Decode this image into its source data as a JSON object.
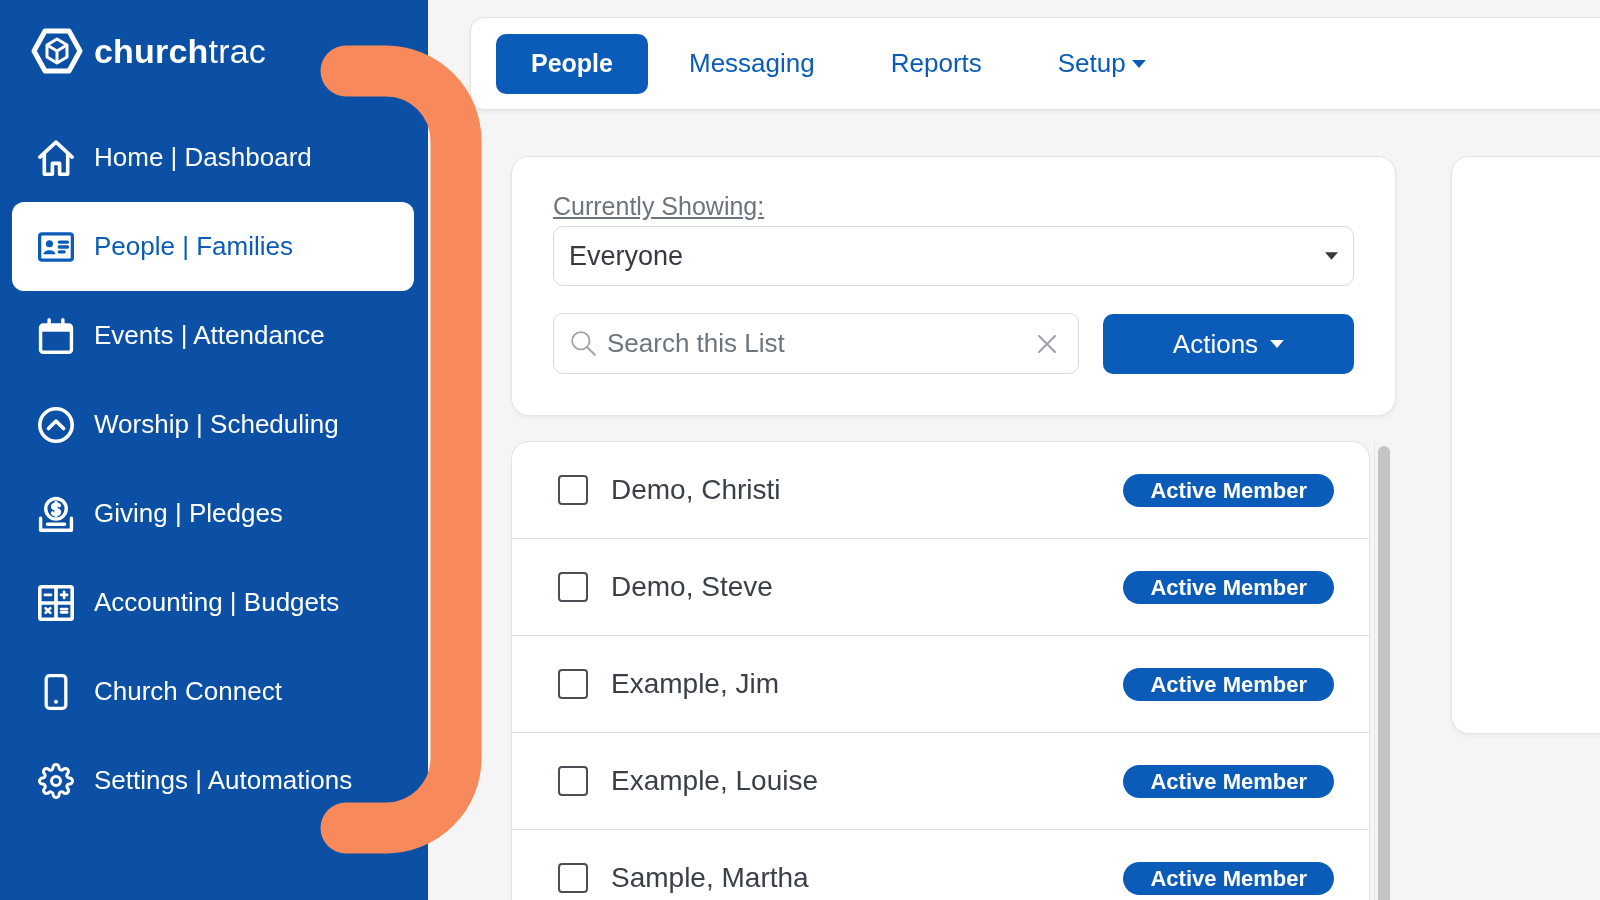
{
  "logo": {
    "wordmark": "**church**trac"
  },
  "sidebar": {
    "items": [
      {
        "label": "Home | Dashboard",
        "selected": false
      },
      {
        "label": "People | Families",
        "selected": true
      },
      {
        "label": "Events | Attendance",
        "selected": false
      },
      {
        "label": "Worship | Scheduling",
        "selected": false
      },
      {
        "label": "Giving | Pledges",
        "selected": false
      },
      {
        "label": "Accounting | Budgets",
        "selected": false
      },
      {
        "label": "Church Connect",
        "selected": false
      },
      {
        "label": "Settings | Automations",
        "selected": false
      }
    ]
  },
  "top_nav": {
    "tabs": [
      {
        "label": "People",
        "selected": true,
        "dropdown": false
      },
      {
        "label": "Messaging",
        "selected": false,
        "dropdown": false
      },
      {
        "label": "Reports",
        "selected": false,
        "dropdown": false
      },
      {
        "label": "Setup",
        "selected": false,
        "dropdown": true
      }
    ]
  },
  "filter": {
    "label": "Currently Showing:",
    "dropdown_value": "Everyone",
    "search": {
      "placeholder": "Search this List"
    },
    "actions_button": "Actions"
  },
  "people": [
    {
      "name": "Demo, Christi",
      "checked": false,
      "badge": "Active Member"
    },
    {
      "name": "Demo, Steve",
      "checked": false,
      "badge": "Active Member"
    },
    {
      "name": "Example, Jim",
      "checked": false,
      "badge": "Active Member"
    },
    {
      "name": "Example, Louise",
      "checked": false,
      "badge": "Active Member"
    },
    {
      "name": "Sample, Martha",
      "checked": false,
      "badge": "Active Member"
    }
  ]
}
